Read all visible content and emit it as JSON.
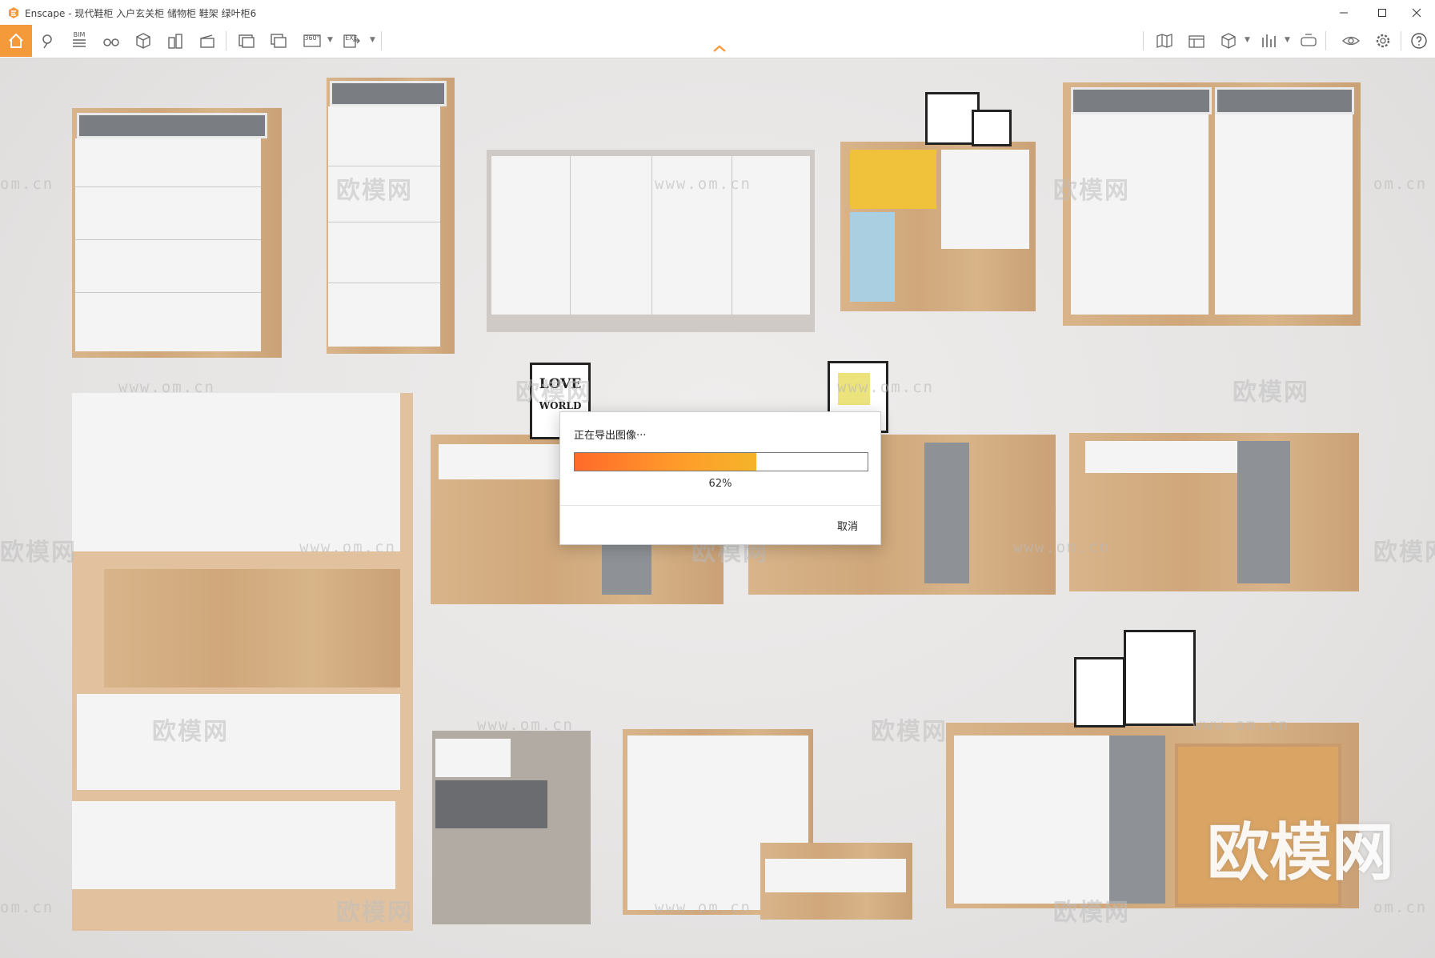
{
  "window": {
    "app_name": "Enscape",
    "title": "Enscape - 现代鞋柜 入户玄关柜 储物柜 鞋架 绿叶柜6",
    "accent_color": "#f49a3a"
  },
  "toolbar": {
    "bim_label": "BIM",
    "pano_label": "360°",
    "exe_label": "EXE"
  },
  "watermarks": {
    "brand": "欧模网",
    "url": "www.om.cn",
    "url_short": "om.cn"
  },
  "artwork": {
    "love_line1": "LOVE",
    "love_line2": "WORLD"
  },
  "export_dialog": {
    "title": "正在导出图像···",
    "progress_percent": 62,
    "progress_label": "62%",
    "cancel_label": "取消"
  }
}
